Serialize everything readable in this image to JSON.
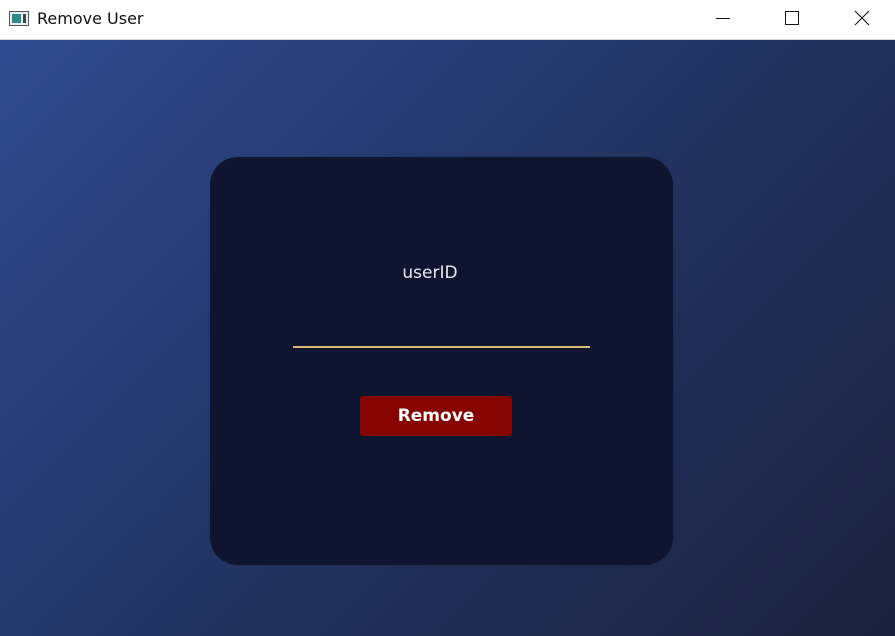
{
  "window": {
    "title": "Remove User",
    "app_icon": "window-app-icon",
    "controls": {
      "minimize_icon": "minimize-icon",
      "maximize_icon": "maximize-icon",
      "close_icon": "close-icon"
    }
  },
  "form": {
    "field_label": "userID",
    "field_value": "",
    "button_label": "Remove"
  },
  "colors": {
    "background_gradient_start": "#2f4b8f",
    "background_gradient_end": "#1b2240",
    "card": "#10152f",
    "input_underline": "#d9b870",
    "button": "#870404",
    "text": "#e8e8f0"
  }
}
